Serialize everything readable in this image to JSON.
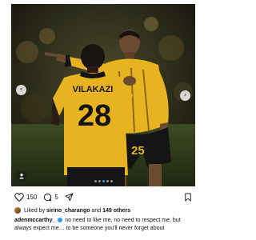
{
  "post": {
    "image_alt": "Two Kaizer Chiefs footballers celebrating",
    "jersey": {
      "name": "VILAKAZI",
      "number": "28",
      "partial_number": "25"
    },
    "carousel": {
      "total_slides": 5,
      "active_index": 2
    },
    "actions": {
      "like_count": "150",
      "comment_count": "5"
    },
    "likes": {
      "prefix": "Liked by",
      "first_user": "sirino_charango",
      "and": "and",
      "others": "149 others"
    },
    "caption": {
      "username": "adenmccarthy_",
      "verified": true,
      "text": "no need to like me, no need to respect me, but always expect me… to be someone you'll never forget about"
    }
  },
  "colors": {
    "jersey_gold": "#e8b321",
    "shorts_black": "#141414",
    "verified_blue": "#3897f0",
    "dot_active": "#3897f0"
  },
  "icons": [
    "chevron-left-icon",
    "chevron-right-icon",
    "person-tag-icon",
    "heart-icon",
    "comment-icon",
    "share-icon",
    "bookmark-icon",
    "verified-icon"
  ]
}
